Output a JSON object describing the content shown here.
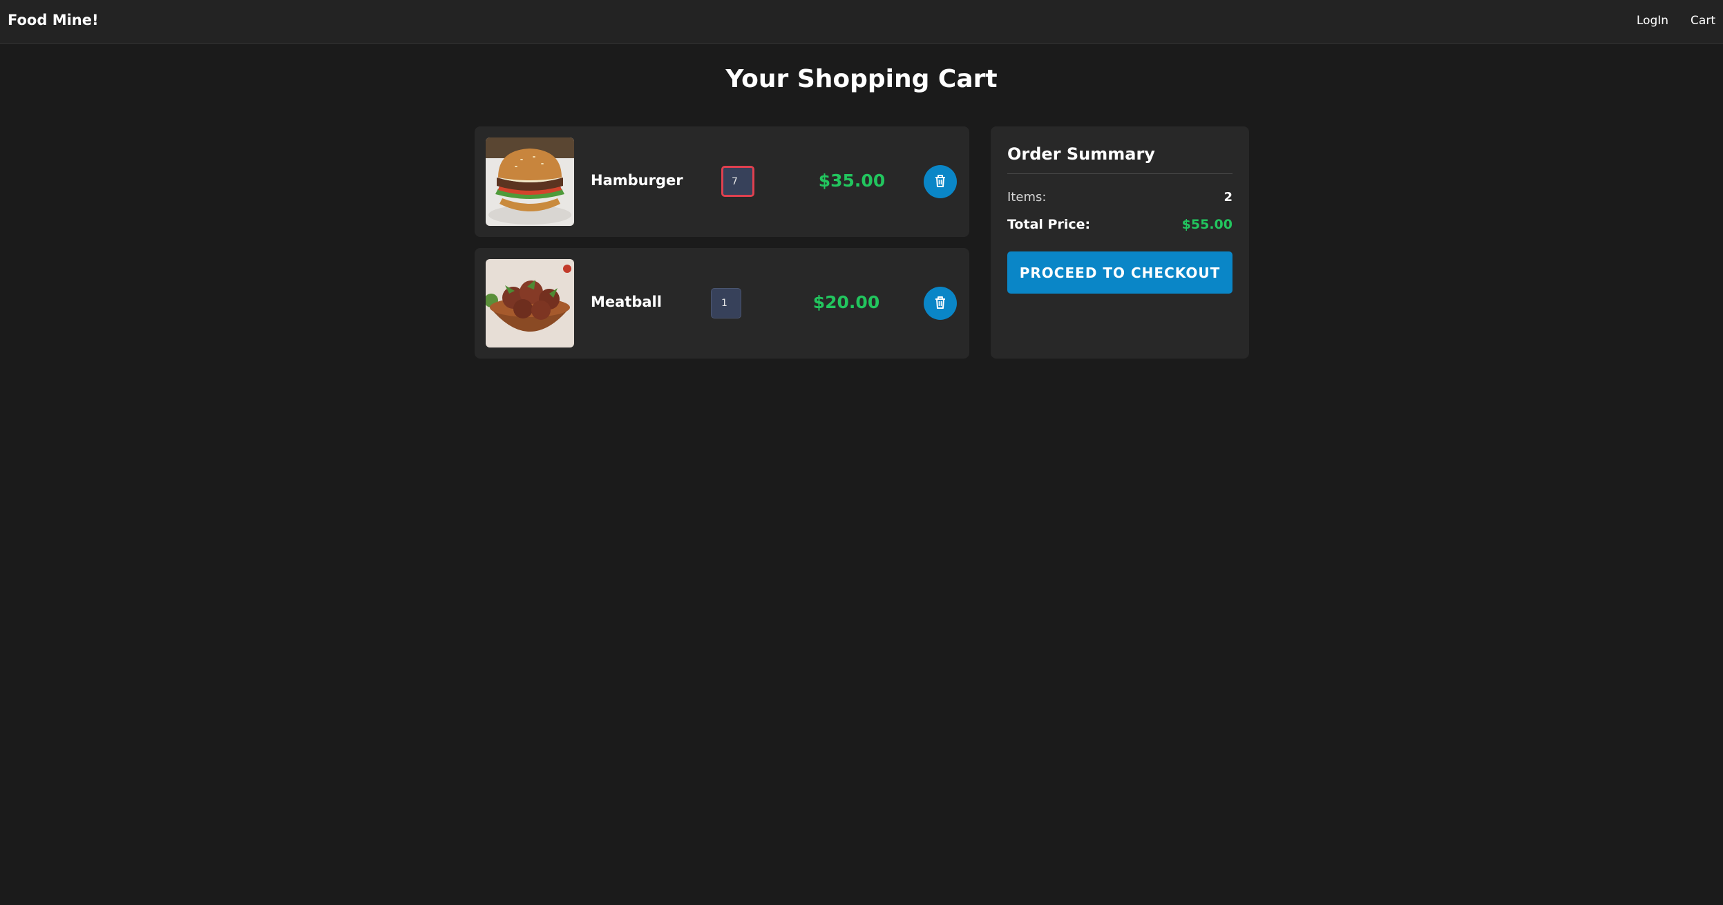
{
  "navbar": {
    "brand": "Food Mine!",
    "links": [
      {
        "label": "LogIn"
      },
      {
        "label": "Cart"
      }
    ]
  },
  "page": {
    "title": "Your Shopping Cart"
  },
  "cart": {
    "items": [
      {
        "name": "Hamburger",
        "quantity": "7",
        "price": "$35.00",
        "image_icon": "hamburger-image"
      },
      {
        "name": "Meatball",
        "quantity": "1",
        "price": "$20.00",
        "image_icon": "meatball-image"
      }
    ]
  },
  "summary": {
    "title": "Order Summary",
    "items_label": "Items:",
    "items_value": "2",
    "total_label": "Total Price:",
    "total_value": "$55.00",
    "checkout_label": "PROCEED TO CHECKOUT"
  },
  "colors": {
    "background": "#1b1b1b",
    "card": "#282828",
    "accent": "#0a86c7",
    "price": "#22c55e",
    "focus_border": "#e0404f"
  }
}
